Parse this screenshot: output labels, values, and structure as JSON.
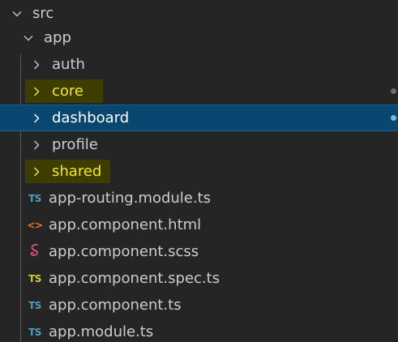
{
  "explorer": {
    "root": {
      "label": "src",
      "expanded": true
    },
    "app": {
      "label": "app",
      "expanded": true
    },
    "folders": [
      {
        "label": "auth",
        "highlighted": false,
        "selected": false
      },
      {
        "label": "core",
        "highlighted": true,
        "selected": false
      },
      {
        "label": "dashboard",
        "highlighted": false,
        "selected": true
      },
      {
        "label": "profile",
        "highlighted": false,
        "selected": false
      },
      {
        "label": "shared",
        "highlighted": true,
        "selected": false
      }
    ],
    "files": [
      {
        "label": "app-routing.module.ts",
        "icon": "TS",
        "type": "typescript"
      },
      {
        "label": "app.component.html",
        "icon": "<>",
        "type": "html"
      },
      {
        "label": "app.component.scss",
        "icon": "sass-icon",
        "type": "scss"
      },
      {
        "label": "app.component.spec.ts",
        "icon": "TS",
        "type": "typescript-spec"
      },
      {
        "label": "app.component.ts",
        "icon": "TS",
        "type": "typescript"
      },
      {
        "label": "app.module.ts",
        "icon": "TS",
        "type": "typescript"
      }
    ]
  },
  "colors": {
    "background": "#252526",
    "selected_row": "#094771",
    "highlight": "#3d3d00",
    "highlight_text": "#f5e52a",
    "ts_icon": "#519aba",
    "ts_spec_icon": "#cbcb41",
    "html_icon": "#e37933",
    "scss_icon": "#f55385"
  }
}
